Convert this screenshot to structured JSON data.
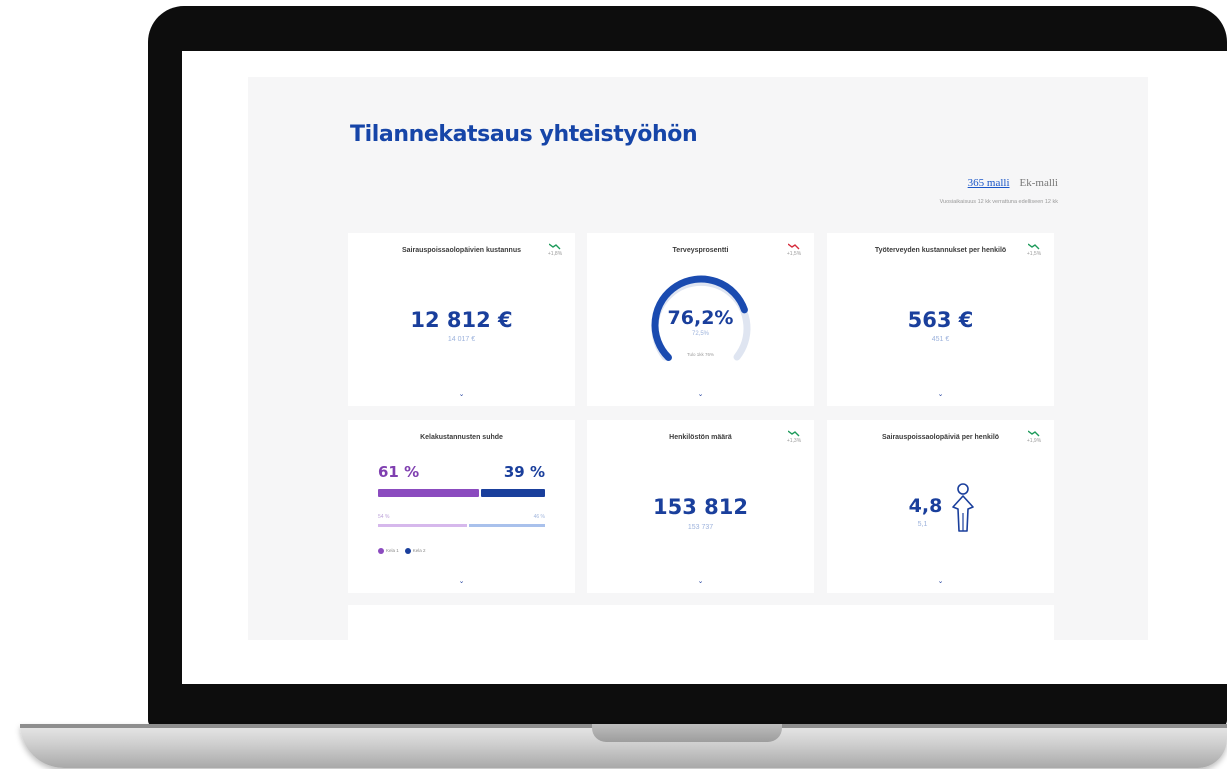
{
  "page": {
    "title": "Tilannekatsaus yhteistyöhön",
    "model_toggle": {
      "active": "365 malli",
      "inactive": "Ek-malli"
    },
    "note": "Vuosiaikaisuus 12 kk verrattuna edelliseen 12 kk"
  },
  "colors": {
    "brand_blue": "#1a3f9c",
    "purple": "#7f3fb0",
    "trend_up": "#1d9a5a",
    "trend_down": "#d62a3a"
  },
  "cards": [
    {
      "title": "Sairauspoissaolopäivien kustannus",
      "trend": "+1,8%",
      "trend_dir": "down-green",
      "value": "12 812 €",
      "previous": "14 017 €"
    },
    {
      "title": "Terveysprosentti",
      "trend": "+1,5%",
      "trend_dir": "down-red",
      "value": "76,2%",
      "previous": "72,5%",
      "caption": "Tulo 1kk 76%",
      "gauge_fraction": 0.762
    },
    {
      "title": "Työterveyden kustannukset per henkilö",
      "trend": "+1,5%",
      "trend_dir": "down-green",
      "value": "563 €",
      "previous": "451 €"
    },
    {
      "title": "Kelakustannusten suhde",
      "left_pct": "61 %",
      "right_pct": "39 %",
      "left_prev": "54 %",
      "right_prev": "46 %",
      "left_fraction": 0.61,
      "right_fraction": 0.39,
      "legend": [
        "Kela 1",
        "Kela 2"
      ]
    },
    {
      "title": "Henkilöstön määrä",
      "trend": "+1,3%",
      "trend_dir": "down-green",
      "value": "153 812",
      "previous": "153 737"
    },
    {
      "title": "Sairauspoissaolopäiviä per henkilö",
      "trend": "+1,9%",
      "trend_dir": "down-green",
      "value": "4,8",
      "previous": "5,1"
    }
  ]
}
